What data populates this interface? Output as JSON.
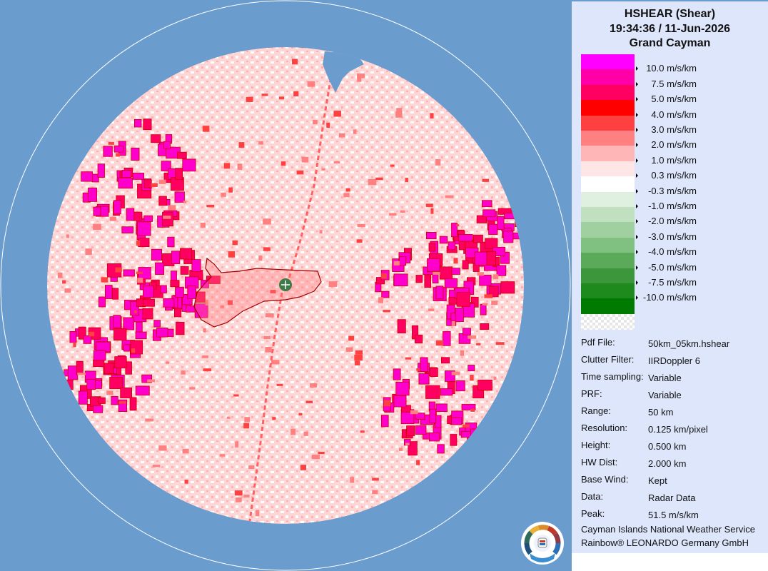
{
  "header": {
    "product": "HSHEAR (Shear)",
    "datetime": "19:34:36 / 11-Jun-2026",
    "site": "Grand Cayman"
  },
  "legend": {
    "entries": [
      {
        "label": "10.0 m/s/km",
        "color": "#ff00ff"
      },
      {
        "label": "7.5 m/s/km",
        "color": "#ff00a8"
      },
      {
        "label": "5.0 m/s/km",
        "color": "#ff0060"
      },
      {
        "label": "4.0 m/s/km",
        "color": "#ff0000"
      },
      {
        "label": "3.0 m/s/km",
        "color": "#ff4040"
      },
      {
        "label": "2.0 m/s/km",
        "color": "#ff8080"
      },
      {
        "label": "1.0 m/s/km",
        "color": "#ffb6b6"
      },
      {
        "label": "0.3 m/s/km",
        "color": "#ffe6e6"
      },
      {
        "label": "-0.3 m/s/km",
        "color": "#ffffff"
      },
      {
        "label": "-1.0 m/s/km",
        "color": "#e0f0e0"
      },
      {
        "label": "-2.0 m/s/km",
        "color": "#c0e0c0"
      },
      {
        "label": "-3.0 m/s/km",
        "color": "#a0d0a0"
      },
      {
        "label": "-4.0 m/s/km",
        "color": "#80c080"
      },
      {
        "label": "-5.0 m/s/km",
        "color": "#5aaa5a"
      },
      {
        "label": "-7.5 m/s/km",
        "color": "#3c963c"
      },
      {
        "label": "-10.0 m/s/km",
        "color": "#1e8a1e"
      }
    ],
    "bottom_color": "#007a00"
  },
  "info": [
    {
      "key": "Pdf File:",
      "value": "50km_05km.hshear"
    },
    {
      "key": "Clutter Filter:",
      "value": "IIRDoppler 6"
    },
    {
      "key": "Time sampling:",
      "value": "Variable"
    },
    {
      "key": "PRF:",
      "value": "Variable"
    },
    {
      "key": "Range:",
      "value": "50 km"
    },
    {
      "key": "Resolution:",
      "value": "0.125 km/pixel"
    },
    {
      "key": "Height:",
      "value": "0.500 km"
    },
    {
      "key": "HW Dist:",
      "value": "2.000 km"
    },
    {
      "key": "Base Wind:",
      "value": "Kept"
    },
    {
      "key": "Data:",
      "value": "Radar Data"
    },
    {
      "key": "Peak:",
      "value": "51.5 m/s/km"
    }
  ],
  "credits": {
    "line1": "Cayman Islands National Weather Service",
    "line2": "Rainbow® LEONARDO Germany GmbH"
  },
  "map": {
    "background_color": "#6a9ccd",
    "range_ring_color": "#ffffff",
    "radar_marker_color": "#3f7a4a"
  }
}
